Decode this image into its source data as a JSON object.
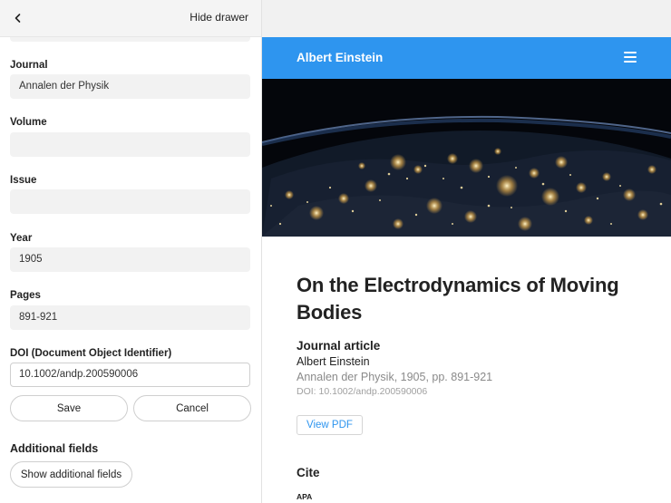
{
  "drawer": {
    "hide_label": "Hide drawer",
    "fields": {
      "journal": {
        "label": "Journal",
        "value": "Annalen der Physik"
      },
      "volume": {
        "label": "Volume",
        "value": ""
      },
      "issue": {
        "label": "Issue",
        "value": ""
      },
      "year": {
        "label": "Year",
        "value": "1905"
      },
      "pages": {
        "label": "Pages",
        "value": "891-921"
      },
      "doi": {
        "label": "DOI (Document Object Identifier)",
        "value": "10.1002/andp.200590006"
      }
    },
    "save_label": "Save",
    "cancel_label": "Cancel",
    "additional_title": "Additional fields",
    "show_additional_label": "Show additional fields"
  },
  "site": {
    "title": "Albert Einstein",
    "accent_color": "#2e95ef"
  },
  "article": {
    "title": "On the Electrodynamics of Moving Bodies",
    "type": "Journal article",
    "author": "Albert Einstein",
    "citation": "Annalen der Physik, 1905, pp. 891-921",
    "doi": "DOI: 10.1002/andp.200590006",
    "view_pdf_label": "View PDF",
    "cite_heading": "Cite",
    "apa_label": "APA"
  }
}
